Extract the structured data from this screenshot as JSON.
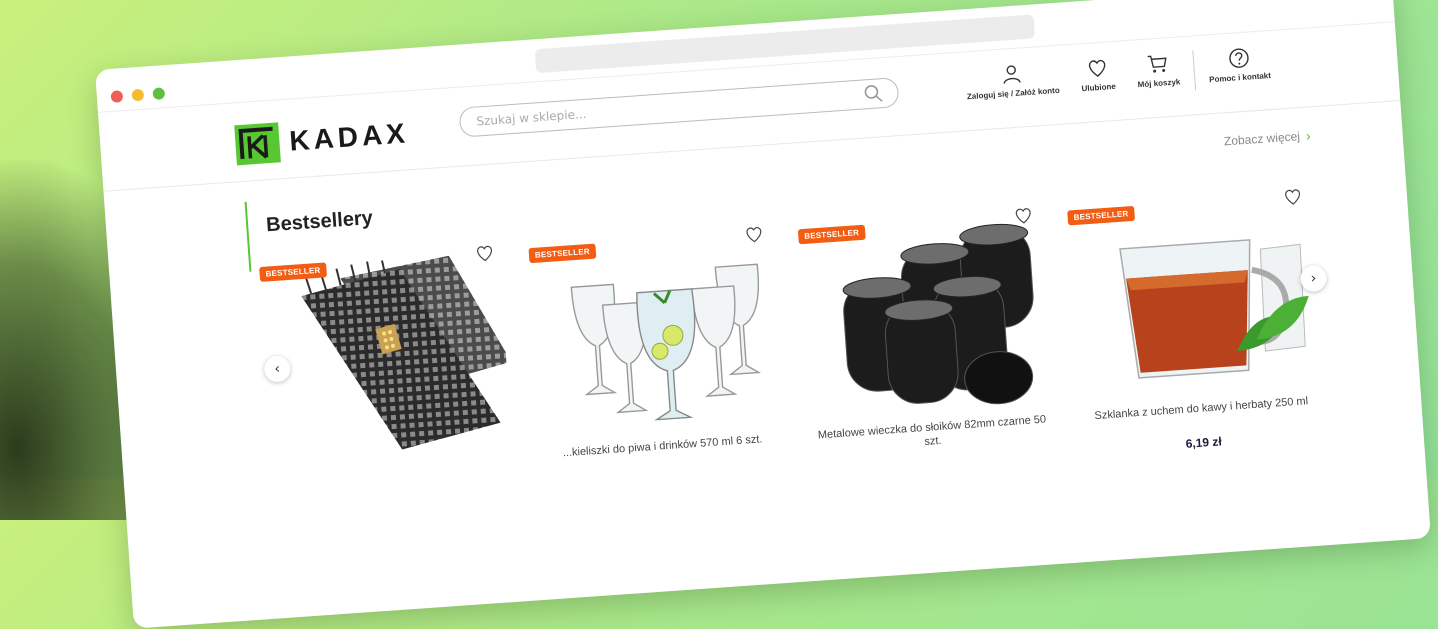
{
  "browser": {
    "dots": [
      "red",
      "yellow",
      "green"
    ]
  },
  "header": {
    "logo_text": "KADAX",
    "search": {
      "placeholder": "Szukaj w sklepie..."
    },
    "nav": [
      {
        "icon": "user-icon",
        "label": "Zaloguj się / Załóż konto"
      },
      {
        "icon": "heart-icon",
        "label": "Ulubione"
      },
      {
        "icon": "cart-icon",
        "label": "Mój koszyk"
      },
      {
        "icon": "help-icon",
        "label": "Pomoc i kontakt"
      }
    ]
  },
  "section": {
    "title": "Bestsellery",
    "see_more": "Zobacz więcej"
  },
  "products": [
    {
      "badge": "BESTSELLER",
      "name": "",
      "price": ""
    },
    {
      "badge": "BESTSELLER",
      "name": "...kieliszki do piwa i drinków 570 ml 6 szt.",
      "price": ""
    },
    {
      "badge": "BESTSELLER",
      "name": "Metalowe wieczka do słoików 82mm czarne 50 szt.",
      "price": ""
    },
    {
      "badge": "BESTSELLER",
      "name": "Szklanka z uchem do kawy i herbaty 250 ml",
      "price": "6,19 zł"
    }
  ],
  "colors": {
    "brand": "#58c832",
    "badge": "#f25c13",
    "price": "#1a1a40"
  }
}
